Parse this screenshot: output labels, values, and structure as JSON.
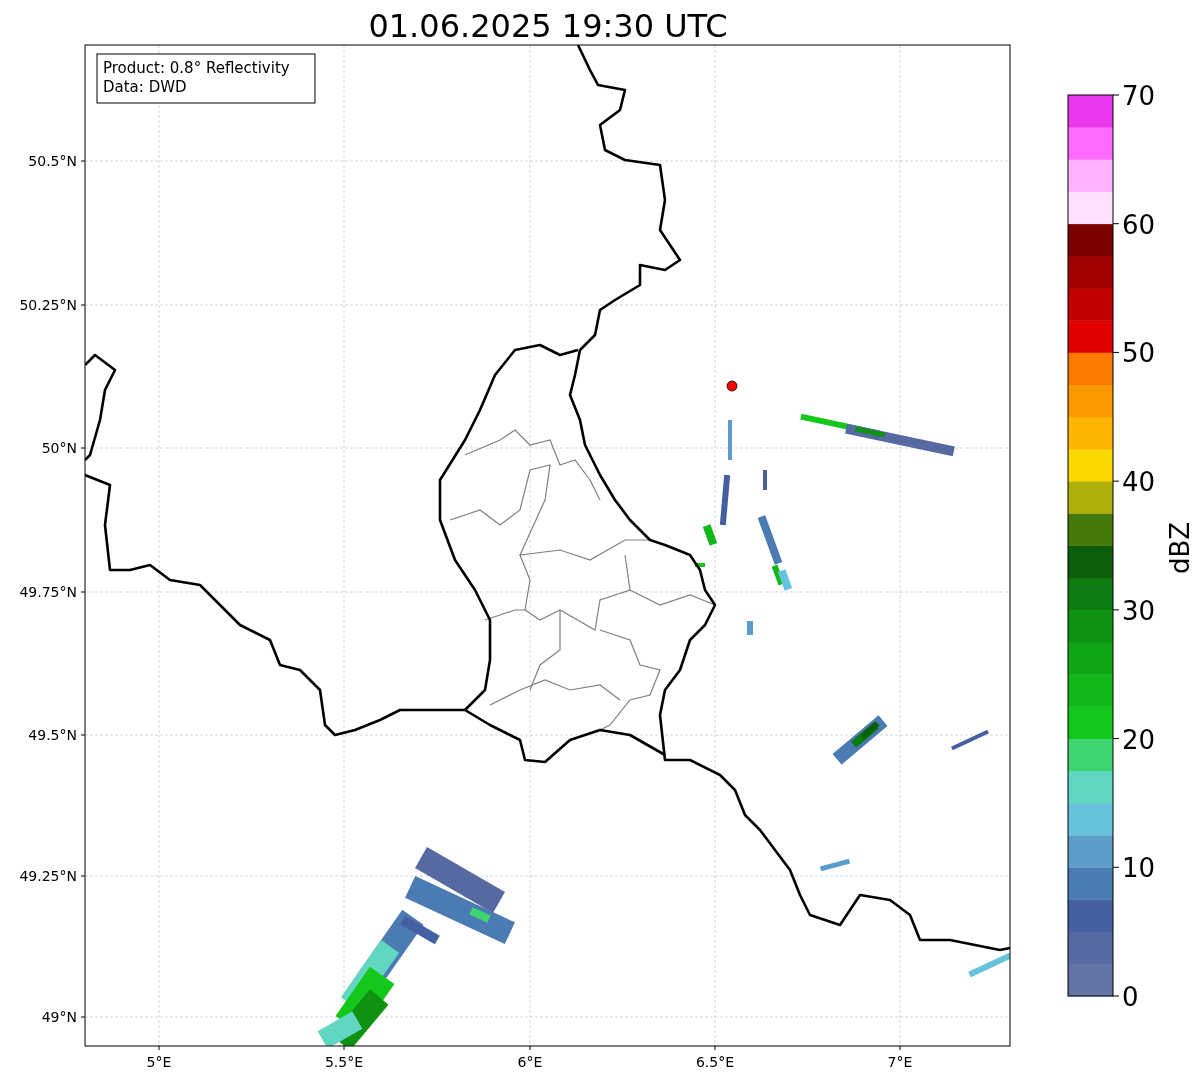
{
  "title": "01.06.2025 19:30 UTC",
  "info_box": {
    "lines": [
      "Product: 0.8° Reflectivity",
      "Data: DWD"
    ]
  },
  "map": {
    "yticks": [
      "50.5°N",
      "50.25°N",
      "50°N",
      "49.75°N",
      "49.5°N",
      "49.25°N",
      "49°N"
    ],
    "xticks": [
      "5°E",
      "5.5°E",
      "6°E",
      "6.5°E",
      "7°E"
    ]
  },
  "colorbar": {
    "label": "dBZ",
    "ticks": [
      "70",
      "60",
      "50",
      "40",
      "30",
      "20",
      "10",
      "0"
    ],
    "levels": [
      {
        "color": "#6574a6"
      },
      {
        "color": "#5669a0"
      },
      {
        "color": "#4560a2"
      },
      {
        "color": "#4a7bb3"
      },
      {
        "color": "#5b9dc8"
      },
      {
        "color": "#67c2dc"
      },
      {
        "color": "#61d7c2"
      },
      {
        "color": "#3ed56f"
      },
      {
        "color": "#13c81a"
      },
      {
        "color": "#12b81a"
      },
      {
        "color": "#10a514"
      },
      {
        "color": "#0f9112"
      },
      {
        "color": "#0d7b10"
      },
      {
        "color": "#0b5e0c"
      },
      {
        "color": "#457a0a"
      },
      {
        "color": "#adb00a"
      },
      {
        "color": "#fdd700"
      },
      {
        "color": "#fdb500"
      },
      {
        "color": "#fc9900"
      },
      {
        "color": "#fc7a00"
      },
      {
        "color": "#e00000"
      },
      {
        "color": "#c10000"
      },
      {
        "color": "#a00000"
      },
      {
        "color": "#7b0000"
      },
      {
        "color": "#ffe0ff"
      },
      {
        "color": "#ffb3ff"
      },
      {
        "color": "#ff6aff"
      },
      {
        "color": "#e938ee"
      }
    ]
  }
}
